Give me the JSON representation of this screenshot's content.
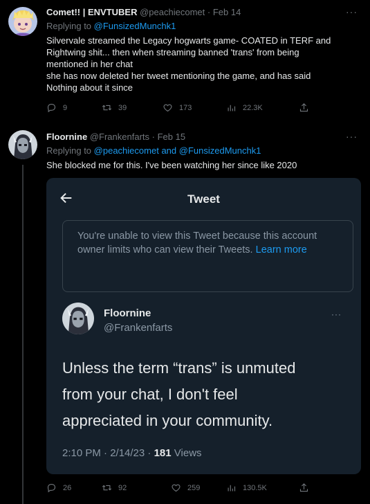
{
  "tweets": [
    {
      "author_name": "Comet!! | ENVTUBER",
      "handle": "@peachiecomet",
      "separator": "·",
      "date": "Feb 14",
      "replying_prefix": "Replying to",
      "replying_to": "@FunsizedMunchk1",
      "text_lines": [
        "Silvervale streamed the Legacy hogwarts game- COATED in TERF and",
        "Rightwing shit... then when streaming banned 'trans' from being",
        "mentioned in her chat",
        "she has now deleted her tweet mentioning the game, and has said",
        "Nothing about it since"
      ],
      "stats": {
        "replies": "9",
        "retweets": "39",
        "likes": "173",
        "views": "22.3K"
      }
    },
    {
      "author_name": "Floornine",
      "handle": "@Frankenfarts",
      "separator": "·",
      "date": "Feb 15",
      "replying_prefix": "Replying to",
      "replying_to_1": "@peachiecomet",
      "replying_and": "and",
      "replying_to_2": "@FunsizedMunchk1",
      "text": "She blocked me for this. I've been watching her since like 2020",
      "stats": {
        "replies": "26",
        "retweets": "92",
        "likes": "259",
        "views": "130.5K"
      }
    }
  ],
  "embedded_screenshot": {
    "header_title": "Tweet",
    "notice_text": "You're unable to view this Tweet because this account owner limits who can view their Tweets.",
    "notice_link": "Learn more",
    "author_name": "Floornine",
    "handle": "@Frankenfarts",
    "text_lines": [
      "Unless the term “trans” is unmuted",
      "from your chat, I don't feel",
      "appreciated in your community."
    ],
    "timestamp": "2:10 PM · 2/14/23 ·",
    "views_count": "181",
    "views_label": "Views"
  },
  "more_icon_text": "···",
  "colors": {
    "background": "#000000",
    "link": "#1d9bf0",
    "muted": "#71767b",
    "embed_bg": "#15202b"
  }
}
